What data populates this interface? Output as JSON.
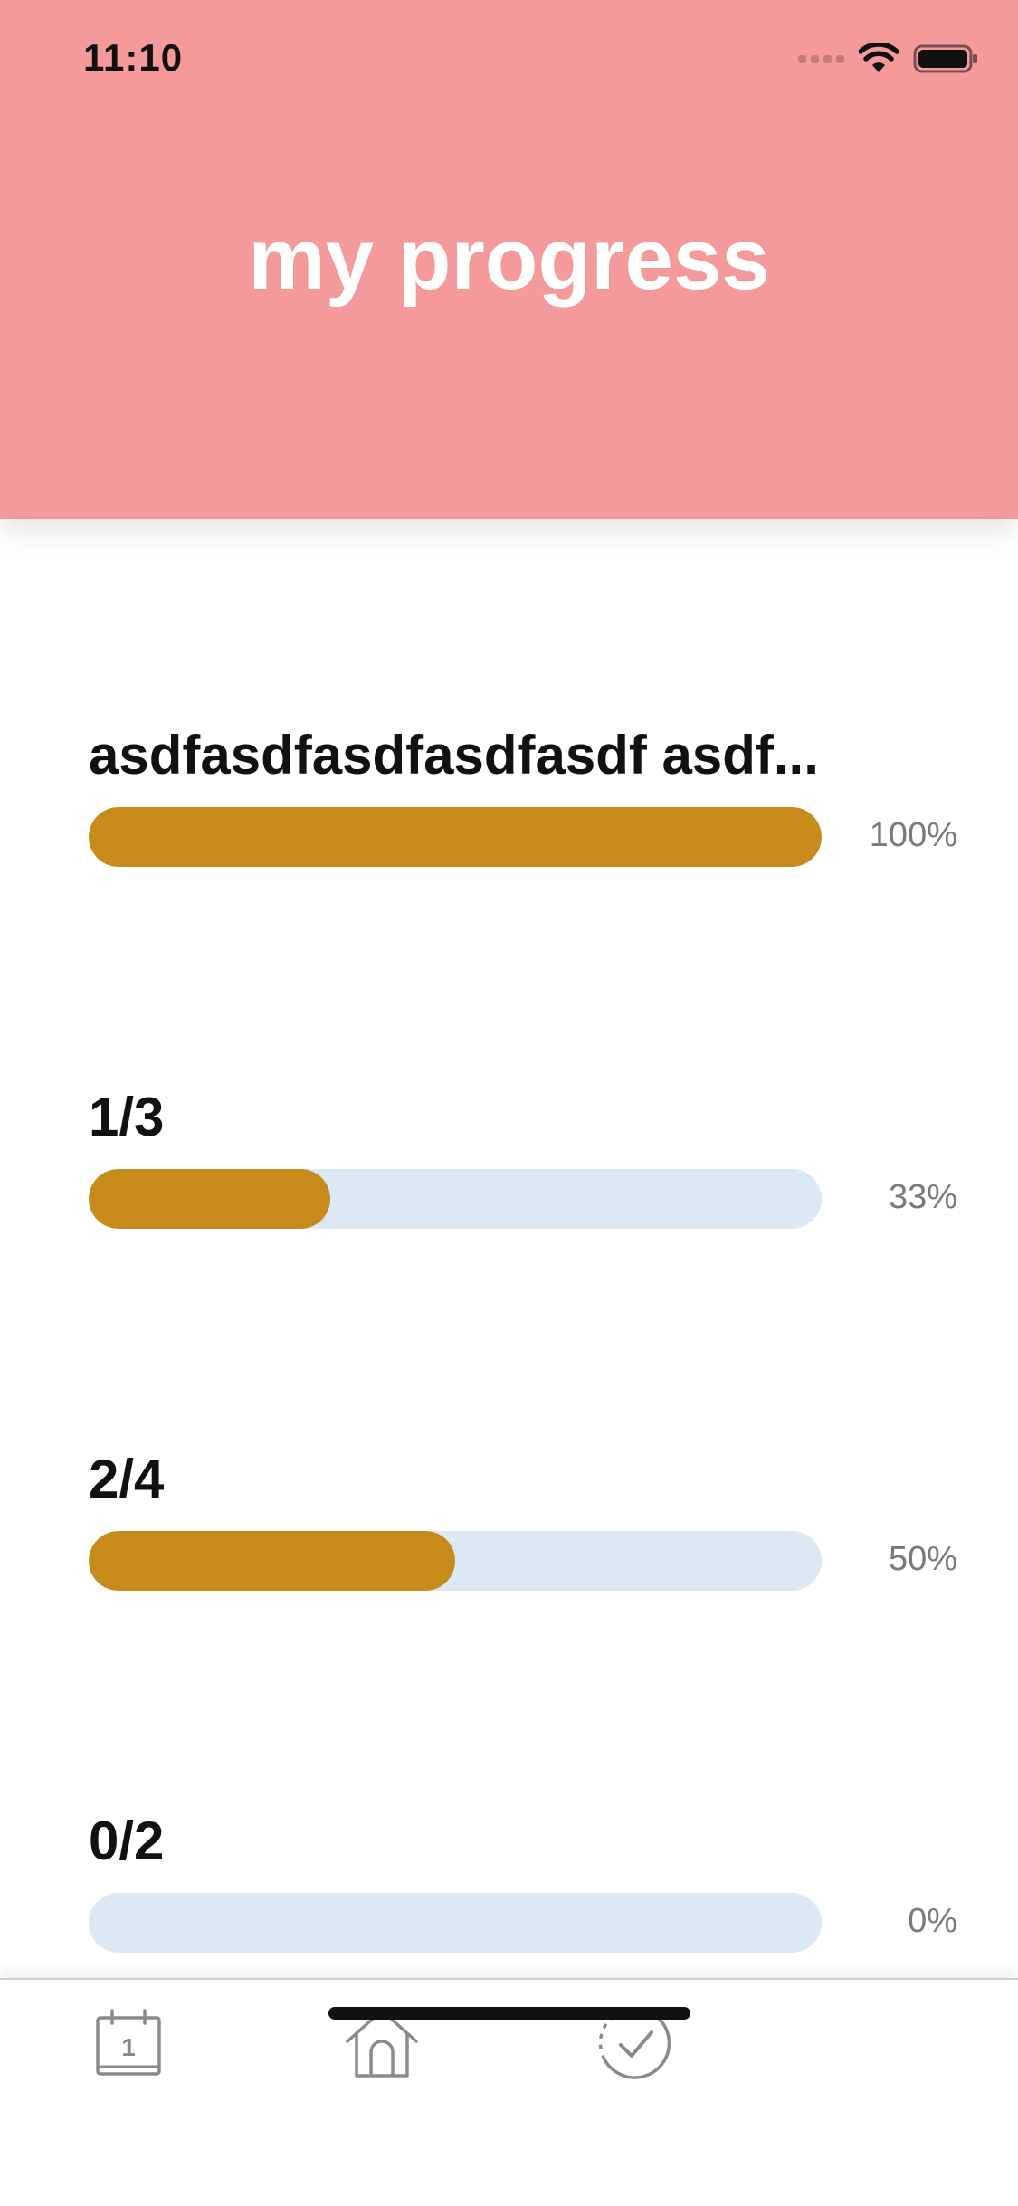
{
  "status_bar": {
    "time": "11:10"
  },
  "header": {
    "title": "my progress",
    "background_color": "#F49A9A"
  },
  "progress_items": [
    {
      "title": "asdfasdfasdfasdfasdf asdf...",
      "percent_label": "100%",
      "progress": 1.0
    },
    {
      "title": "1/3",
      "percent_label": "33%",
      "progress": 0.33
    },
    {
      "title": "2/4",
      "percent_label": "50%",
      "progress": 0.5
    },
    {
      "title": "0/2",
      "percent_label": "0%",
      "progress": 0.0
    }
  ],
  "colors": {
    "fill": "#C68B1B",
    "track": "#DCE8F2",
    "percent_text": "#7a7a7a"
  },
  "tab_bar": {
    "items": [
      {
        "icon": "calendar-icon",
        "day_number": "1"
      },
      {
        "icon": "home-icon"
      },
      {
        "icon": "progress-check-icon"
      }
    ]
  }
}
